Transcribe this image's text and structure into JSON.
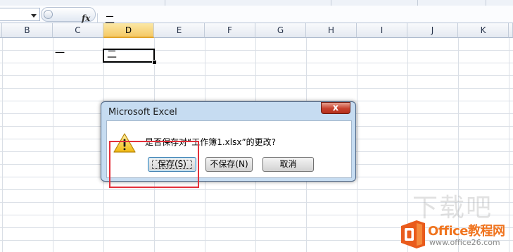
{
  "formula_bar": {
    "fx_label": "fx",
    "value": "二"
  },
  "sheet": {
    "columns": [
      "B",
      "C",
      "D",
      "E",
      "F",
      "G",
      "H",
      "I",
      "J",
      "K"
    ],
    "active_column": "D",
    "cells": {
      "C": "一",
      "D": "二"
    }
  },
  "dialog": {
    "title": "Microsoft Excel",
    "close_glyph": "x",
    "message": "是否保存对“工作簿1.xlsx”的更改?",
    "buttons": {
      "save": "保存(S)",
      "dont_save": "不保存(N)",
      "cancel": "取消"
    },
    "icon": "warning-icon"
  },
  "watermark": {
    "text": "下载吧"
  },
  "brand": {
    "name": "Office教程网",
    "url": "www.office26.com"
  },
  "colors": {
    "highlight": "#e3303a",
    "brand": "#f0741e",
    "active_column": "#f5c965"
  }
}
